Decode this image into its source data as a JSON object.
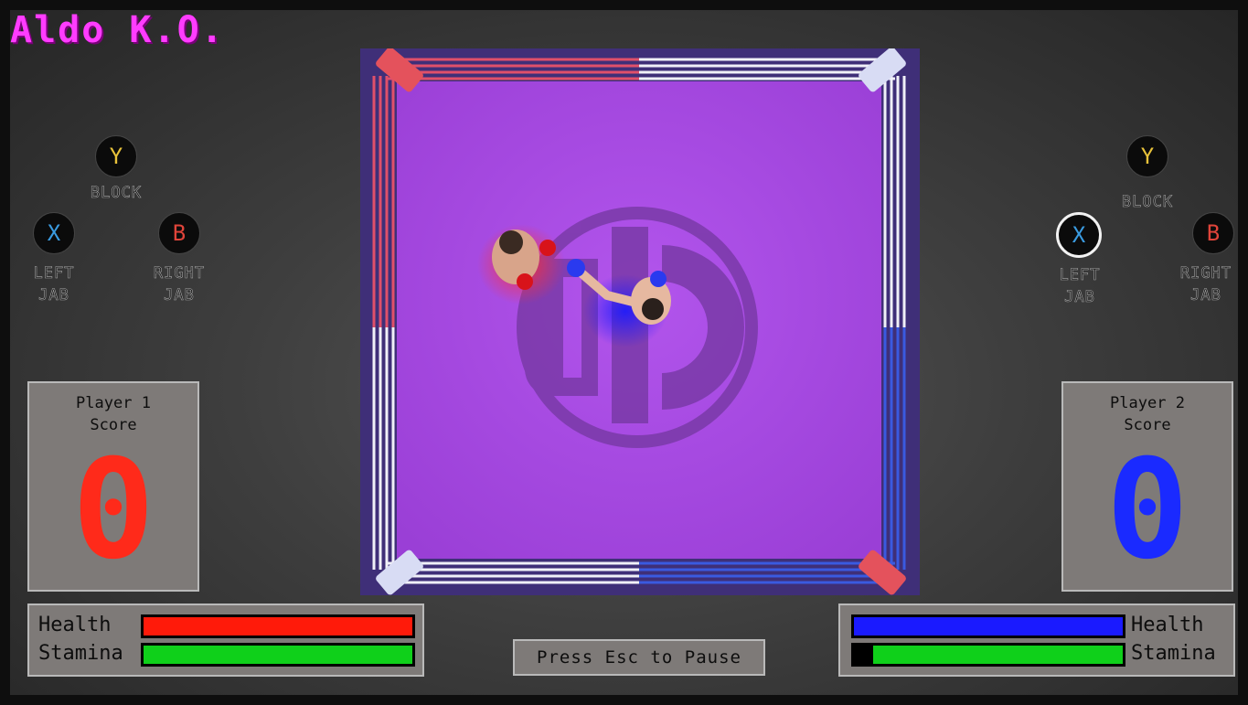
{
  "game": {
    "title": "Aldo K.O."
  },
  "controls": {
    "p1": {
      "y": "Y",
      "x": "X",
      "b": "B",
      "block": "BLOCK",
      "left1": "LEFT",
      "left2": "JAB",
      "right1": "RIGHT",
      "right2": "JAB"
    },
    "p2": {
      "y": "Y",
      "x": "X",
      "b": "B",
      "block": "BLOCK",
      "left1": "LEFT",
      "left2": "JAB",
      "right1": "RIGHT",
      "right2": "JAB"
    }
  },
  "player1": {
    "label_line1": "Player 1",
    "label_line2": "Score",
    "score": "0",
    "color": "#ff2a1a",
    "health_label": "Health",
    "stamina_label": "Stamina",
    "health": 1.0,
    "stamina": 1.0
  },
  "player2": {
    "label_line1": "Player 2",
    "label_line2": "Score",
    "score": "0",
    "color": "#1a2aff",
    "health_label": "Health",
    "stamina_label": "Stamina",
    "health": 1.0,
    "stamina": 0.93
  },
  "ring": {
    "logo": "OBC",
    "mat_color": "#a449e0"
  },
  "pause_hint": "Press Esc to Pause",
  "colors": {
    "health": "#ff1a0a",
    "stamina": "#0fd01a",
    "p2_health": "#1a1aff"
  }
}
